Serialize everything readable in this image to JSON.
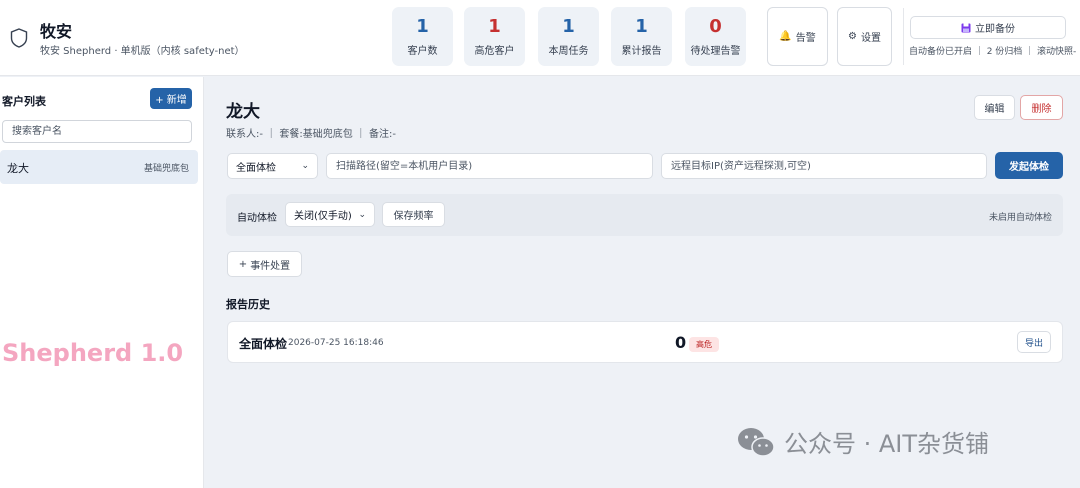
{
  "header": {
    "title": "牧安",
    "subtitle": "牧安 Shepherd · 单机版（内核 safety-net）",
    "stats": [
      {
        "value": "1",
        "label": "客户数",
        "color": "#2563a8"
      },
      {
        "value": "1",
        "label": "高危客户",
        "color": "#c53030"
      },
      {
        "value": "1",
        "label": "本周任务",
        "color": "#2563a8"
      },
      {
        "value": "1",
        "label": "累计报告",
        "color": "#2563a8"
      },
      {
        "value": "0",
        "label": "待处理告警",
        "color": "#c53030"
      }
    ],
    "alert_label": "告警",
    "settings_label": "设置",
    "backup_label": "立即备份",
    "backup_status": "自动备份已开启 ｜ 2 份归档 ｜ 滚动快照-"
  },
  "sidebar": {
    "title": "客户列表",
    "add_label": "+ 新增",
    "search_placeholder": "搜索客户名",
    "customers": [
      {
        "name": "龙大",
        "package": "基础兜底包"
      }
    ],
    "brand_mark": "Shepherd 1.0"
  },
  "main": {
    "customer_name": "龙大",
    "meta": "联系人:-  ｜  套餐:基础兜底包  ｜  备注:-",
    "edit_label": "编辑",
    "delete_label": "删除",
    "scan_type": "全面体检",
    "path_placeholder": "扫描路径(留空=本机用户目录)",
    "remote_placeholder": "远程目标IP(资产远程探测,可空)",
    "scan_button": "发起体检",
    "auto": {
      "label": "自动体检",
      "mode": "关闭(仅手动)",
      "save_label": "保存频率",
      "status": "未启用自动体检"
    },
    "event_label": "事件处置",
    "history_title": "报告历史",
    "reports": [
      {
        "name": "全面体检",
        "time": "2026-07-25 16:18:46",
        "count": "0",
        "level": "高危",
        "export_label": "导出"
      }
    ]
  },
  "watermark": "公众号 · AIT杂货铺"
}
